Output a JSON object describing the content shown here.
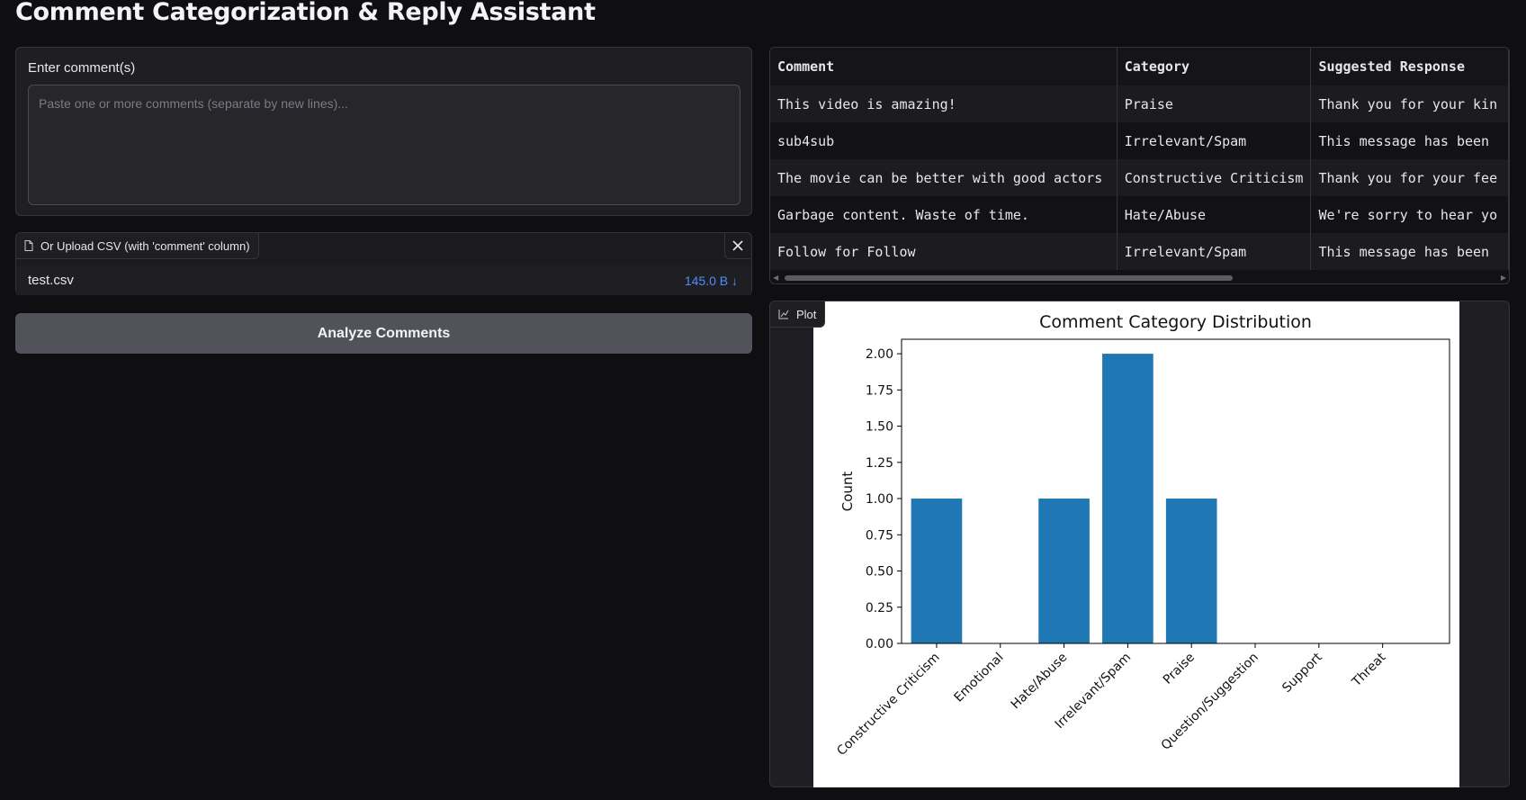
{
  "app": {
    "title": "Comment Categorization & Reply Assistant"
  },
  "input": {
    "label": "Enter comment(s)",
    "placeholder": "Paste one or more comments (separate by new lines)...",
    "value": ""
  },
  "upload": {
    "label": "Or Upload CSV (with 'comment' column)",
    "file_name": "test.csv",
    "file_size": "145.0 B ↓"
  },
  "analyze_button": {
    "label": "Analyze Comments"
  },
  "results_table": {
    "headers": [
      "Comment",
      "Category",
      "Suggested Response"
    ],
    "rows": [
      [
        "This video is amazing!",
        "Praise",
        "Thank you for your kin"
      ],
      [
        "sub4sub",
        "Irrelevant/Spam",
        "This message has been"
      ],
      [
        "The movie can be better with good actors",
        "Constructive Criticism",
        "Thank you for your fee"
      ],
      [
        "Garbage content. Waste of time.",
        "Hate/Abuse",
        "We're sorry to hear yo"
      ],
      [
        "Follow for Follow",
        "Irrelevant/Spam",
        "This message has been"
      ]
    ]
  },
  "plot": {
    "label": "Plot"
  },
  "chart_data": {
    "type": "bar",
    "title": "Comment Category Distribution",
    "xlabel": "",
    "ylabel": "Count",
    "categories": [
      "Constructive Criticism",
      "Emotional",
      "Hate/Abuse",
      "Irrelevant/Spam",
      "Praise",
      "Question/Suggestion",
      "Support",
      "Threat"
    ],
    "values": [
      1,
      0,
      1,
      2,
      1,
      0,
      0,
      0
    ],
    "ylim": [
      0,
      2.1
    ],
    "yticks": [
      "0.00",
      "0.25",
      "0.50",
      "0.75",
      "1.00",
      "1.25",
      "1.50",
      "1.75",
      "2.00"
    ],
    "bar_color": "#1f77b4",
    "grid": false
  },
  "colors": {
    "accent": "#4c8dff",
    "button": "#52525b",
    "background": "#0f0f11"
  }
}
